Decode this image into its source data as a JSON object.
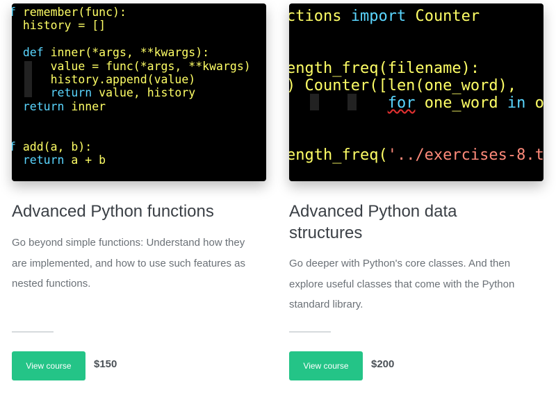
{
  "courses": [
    {
      "title": "Advanced Python functions",
      "description": "Go beyond simple functions: Understand how they are implemented, and how to use such features as nested functions.",
      "button_label": "View course",
      "price": "$150",
      "code": {
        "l1_kw": "f",
        "l1": " remember(func):",
        "l2": "  history = []",
        "l4_kw": "  def",
        "l4": " inner(*args, **kwargs):",
        "l5": "      value = func(*args, **kwargs)",
        "l6": "      history.append(value)",
        "l7_kw": "      return",
        "l7": " value, history",
        "l8_kw": "  return",
        "l8": " inner",
        "l11_kw": "f",
        "l11": " add(a, b):",
        "l12_kw": "  return",
        "l12": " a + b"
      }
    },
    {
      "title": "Advanced Python data structures",
      "description": "Go deeper with Python's core classes. And then explore useful classes that come with the Python standard library.",
      "button_label": "View course",
      "price": "$200",
      "code": {
        "l1a": "ctions ",
        "l1_kw": "import",
        "l1b": " Counter",
        "l4": "ength_freq(filename):",
        "l5": ") Counter([len(one_word),",
        "l6_pre": "           ",
        "l6_kw1": "for",
        "l6_mid": " one_word ",
        "l6_kw2": "in",
        "l6_end": " op",
        "l9a": "ength_freq(",
        "l9_str": "'../exercises-8.t"
      }
    }
  ],
  "colors": {
    "button": "#24c487",
    "title": "#3b4046",
    "description": "#6b7177",
    "code_yellow": "#ffff66",
    "code_keyword": "#5ad6ff",
    "code_string": "#ff8a7a"
  }
}
